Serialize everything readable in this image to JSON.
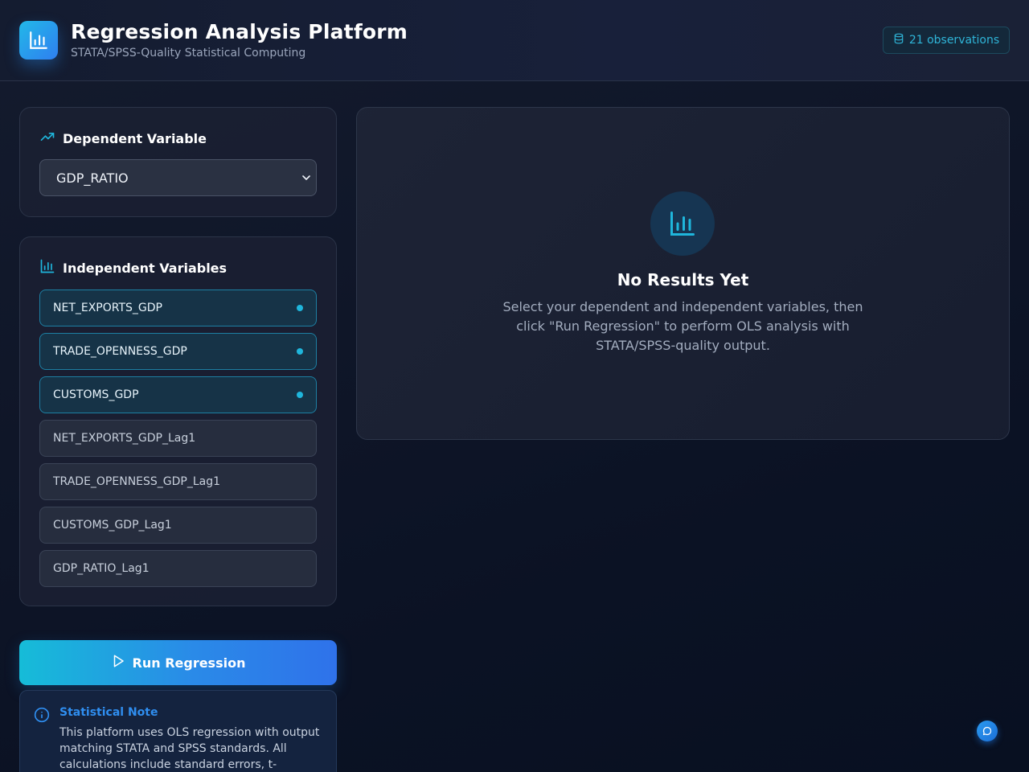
{
  "header": {
    "title": "Regression Analysis Platform",
    "subtitle": "STATA/SPSS-Quality Statistical Computing",
    "badge": "21 observations",
    "logo_icon": "bar-chart-icon",
    "badge_icon": "database-icon"
  },
  "dependent": {
    "title": "Dependent Variable",
    "icon": "trending-up-icon",
    "selected": "GDP_RATIO"
  },
  "independent": {
    "title": "Independent Variables",
    "icon": "bar-chart-icon",
    "items": [
      {
        "label": "NET_EXPORTS_GDP",
        "selected": true
      },
      {
        "label": "TRADE_OPENNESS_GDP",
        "selected": true
      },
      {
        "label": "CUSTOMS_GDP",
        "selected": true
      },
      {
        "label": "NET_EXPORTS_GDP_Lag1",
        "selected": false
      },
      {
        "label": "TRADE_OPENNESS_GDP_Lag1",
        "selected": false
      },
      {
        "label": "CUSTOMS_GDP_Lag1",
        "selected": false
      },
      {
        "label": "GDP_RATIO_Lag1",
        "selected": false
      }
    ]
  },
  "run_button": {
    "label": "Run Regression",
    "icon": "play-icon"
  },
  "note": {
    "title": "Statistical Note",
    "body": "This platform uses OLS regression with output matching STATA and SPSS standards. All calculations include standard errors, t-",
    "icon": "info-icon"
  },
  "results": {
    "title": "No Results Yet",
    "description": "Select your dependent and independent variables, then click \"Run Regression\" to perform OLS analysis with STATA/SPSS-quality output.",
    "icon": "bar-chart-icon"
  },
  "colors": {
    "accent": "#1fb6dc",
    "primary": "#2f72ea",
    "background": "#0f1628"
  }
}
